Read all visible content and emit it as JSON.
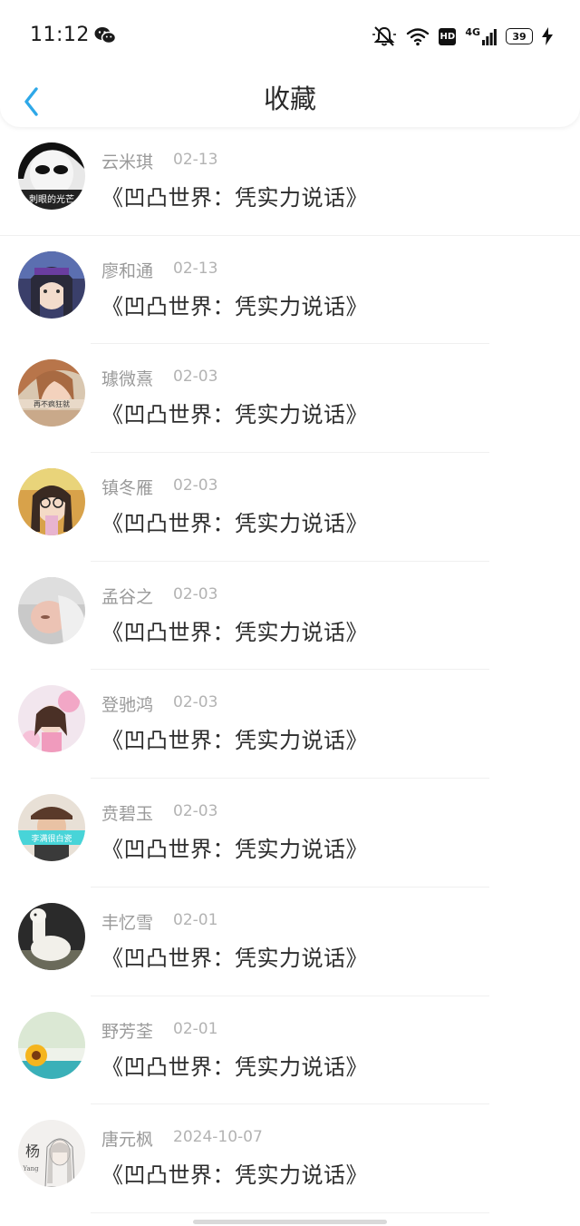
{
  "status": {
    "time": "11:12",
    "network": "4G",
    "hd": "HD",
    "battery": "39"
  },
  "nav": {
    "title": "收藏"
  },
  "items": [
    {
      "name": "云米琪",
      "date": "02-13",
      "text": "《凹凸世界：凭实力说话》",
      "avatar": "avatar-bw-face"
    },
    {
      "name": "廖和通",
      "date": "02-13",
      "text": "《凹凸世界：凭实力说话》",
      "avatar": "avatar-anime-girl"
    },
    {
      "name": "璩微熹",
      "date": "02-03",
      "text": "《凹凸世界：凭实力说话》",
      "avatar": "avatar-girl-portrait"
    },
    {
      "name": "镇冬雁",
      "date": "02-03",
      "text": "《凹凸世界：凭实力说话》",
      "avatar": "avatar-girl-glasses"
    },
    {
      "name": "孟谷之",
      "date": "02-03",
      "text": "《凹凸世界：凭实力说话》",
      "avatar": "avatar-baby"
    },
    {
      "name": "登驰鸿",
      "date": "02-03",
      "text": "《凹凸世界：凭实力说话》",
      "avatar": "avatar-pink-child"
    },
    {
      "name": "贲碧玉",
      "date": "02-03",
      "text": "《凹凸世界：凭实力说话》",
      "avatar": "avatar-boy-hat"
    },
    {
      "name": "丰忆雪",
      "date": "02-01",
      "text": "《凹凸世界：凭实力说话》",
      "avatar": "avatar-alpaca"
    },
    {
      "name": "野芳荃",
      "date": "02-01",
      "text": "《凹凸世界：凭实力说话》",
      "avatar": "avatar-sunflower"
    },
    {
      "name": "唐元枫",
      "date": "2024-10-07",
      "text": "《凹凸世界：凭实力说话》",
      "avatar": "avatar-sketch-girl"
    }
  ],
  "colors": {
    "accent": "#2ea8e8",
    "name": "#9a9a9a",
    "date": "#b3b3b3",
    "text": "#2d2d2d"
  }
}
